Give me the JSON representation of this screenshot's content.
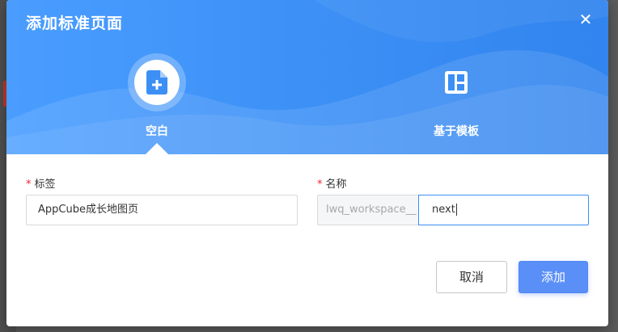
{
  "dialog": {
    "title": "添加标准页面",
    "close_glyph": "✕"
  },
  "page_types": [
    {
      "label": "空白",
      "icon": "blank-page-plus-icon",
      "selected": true
    },
    {
      "label": "基于模板",
      "icon": "template-layout-icon",
      "selected": false
    }
  ],
  "form": {
    "tag": {
      "required_mark": "*",
      "label": "标签",
      "value": "AppCube成长地图页"
    },
    "name": {
      "required_mark": "*",
      "label": "名称",
      "prefix": "lwq_workspace__",
      "value": "next"
    }
  },
  "actions": {
    "cancel_label": "取消",
    "add_label": "添加"
  },
  "colors": {
    "header_blue": "#3b8ff5",
    "primary_button": "#5a8ff7",
    "required_red": "#f5222d"
  }
}
